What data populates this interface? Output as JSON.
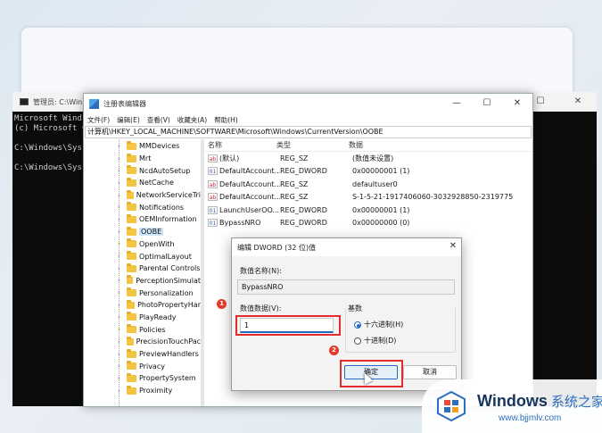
{
  "console": {
    "title": "管理员: C:\\Win",
    "lines": [
      "Microsoft Wind",
      "(c) Microsoft C",
      "",
      "C:\\Windows\\Sys",
      "",
      "C:\\Windows\\Sys"
    ],
    "controls": {
      "min": "—",
      "max": "☐",
      "close": "✕"
    }
  },
  "regedit": {
    "title": "注册表编辑器",
    "controls": {
      "min": "—",
      "max": "☐",
      "close": "✕"
    },
    "menu": [
      "文件(F)",
      "编辑(E)",
      "查看(V)",
      "收藏夹(A)",
      "帮助(H)"
    ],
    "path": "计算机\\HKEY_LOCAL_MACHINE\\SOFTWARE\\Microsoft\\Windows\\CurrentVersion\\OOBE",
    "tree": [
      "MMDevices",
      "Mrt",
      "NcdAutoSetup",
      "NetCache",
      "NetworkServiceTri",
      "Notifications",
      "OEMInformation",
      "OOBE",
      "OpenWith",
      "OptimalLayout",
      "Parental Controls",
      "PerceptionSimulat",
      "Personalization",
      "PhotoPropertyHar",
      "PlayReady",
      "Policies",
      "PrecisionTouchPac",
      "PreviewHandlers",
      "Privacy",
      "PropertySystem",
      "Proximity"
    ],
    "selected_tree": "OOBE",
    "columns": {
      "name": "名称",
      "type": "类型",
      "data": "数据"
    },
    "values": [
      {
        "icon": "ab",
        "name": "(默认)",
        "type": "REG_SZ",
        "data": "(数值未设置)"
      },
      {
        "icon": "dw",
        "name": "DefaultAccount...",
        "type": "REG_DWORD",
        "data": "0x00000001 (1)"
      },
      {
        "icon": "ab",
        "name": "DefaultAccount...",
        "type": "REG_SZ",
        "data": "defaultuser0"
      },
      {
        "icon": "ab",
        "name": "DefaultAccount...",
        "type": "REG_SZ",
        "data": "S-1-5-21-1917406060-3032928850-23197759..."
      },
      {
        "icon": "dw",
        "name": "LaunchUserOO...",
        "type": "REG_DWORD",
        "data": "0x00000001 (1)"
      },
      {
        "icon": "dw",
        "name": "BypassNRO",
        "type": "REG_DWORD",
        "data": "0x00000000 (0)"
      }
    ]
  },
  "dialog": {
    "title": "编辑 DWORD (32 位)值",
    "close": "✕",
    "name_label": "数值名称(N):",
    "name_value": "BypassNRO",
    "data_label": "数值数据(V):",
    "data_value": "1",
    "base_label": "基数",
    "radio_hex": "十六进制(H)",
    "radio_dec": "十进制(D)",
    "selected_base": "hex",
    "ok": "确定",
    "cancel": "取消"
  },
  "annotations": {
    "step1": "1",
    "step2": "2",
    "color": "#e32d2d"
  },
  "watermark": {
    "title": "Windows",
    "title_cn": "系统之家",
    "url": "www.bjjmlv.com"
  }
}
